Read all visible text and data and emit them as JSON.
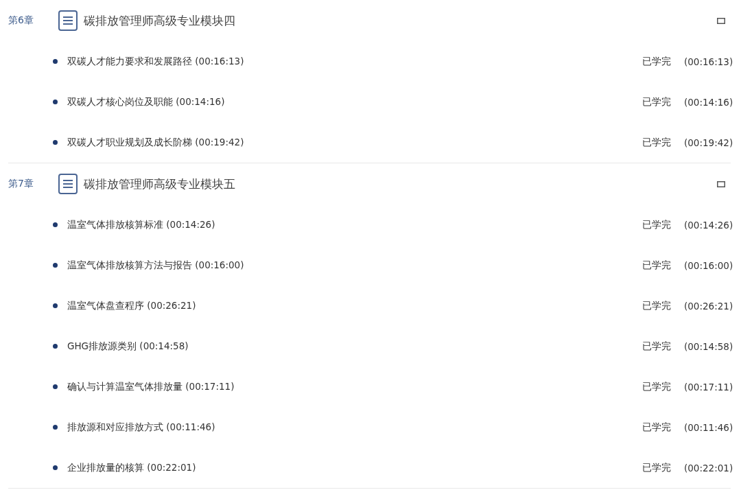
{
  "chapters": [
    {
      "label": "第6章",
      "title": "碳排放管理师高级专业模块四",
      "lessons": [
        {
          "title": "双碳人才能力要求和发展路径 (00:16:13)",
          "status": "已学完",
          "duration": "(00:16:13)"
        },
        {
          "title": "双碳人才核心岗位及职能 (00:14:16)",
          "status": "已学完",
          "duration": "(00:14:16)"
        },
        {
          "title": "双碳人才职业规划及成长阶梯 (00:19:42)",
          "status": "已学完",
          "duration": "(00:19:42)"
        }
      ]
    },
    {
      "label": "第7章",
      "title": "碳排放管理师高级专业模块五",
      "lessons": [
        {
          "title": "温室气体排放核算标准 (00:14:26)",
          "status": "已学完",
          "duration": "(00:14:26)"
        },
        {
          "title": "温室气体排放核算方法与报告 (00:16:00)",
          "status": "已学完",
          "duration": "(00:16:00)"
        },
        {
          "title": "温室气体盘查程序 (00:26:21)",
          "status": "已学完",
          "duration": "(00:26:21)"
        },
        {
          "title": "GHG排放源类别 (00:14:58)",
          "status": "已学完",
          "duration": "(00:14:58)"
        },
        {
          "title": "确认与计算温室气体排放量 (00:17:11)",
          "status": "已学完",
          "duration": "(00:17:11)"
        },
        {
          "title": "排放源和对应排放方式 (00:11:46)",
          "status": "已学完",
          "duration": "(00:11:46)"
        },
        {
          "title": "企业排放量的核算 (00:22:01)",
          "status": "已学完",
          "duration": "(00:22:01)"
        }
      ]
    }
  ]
}
